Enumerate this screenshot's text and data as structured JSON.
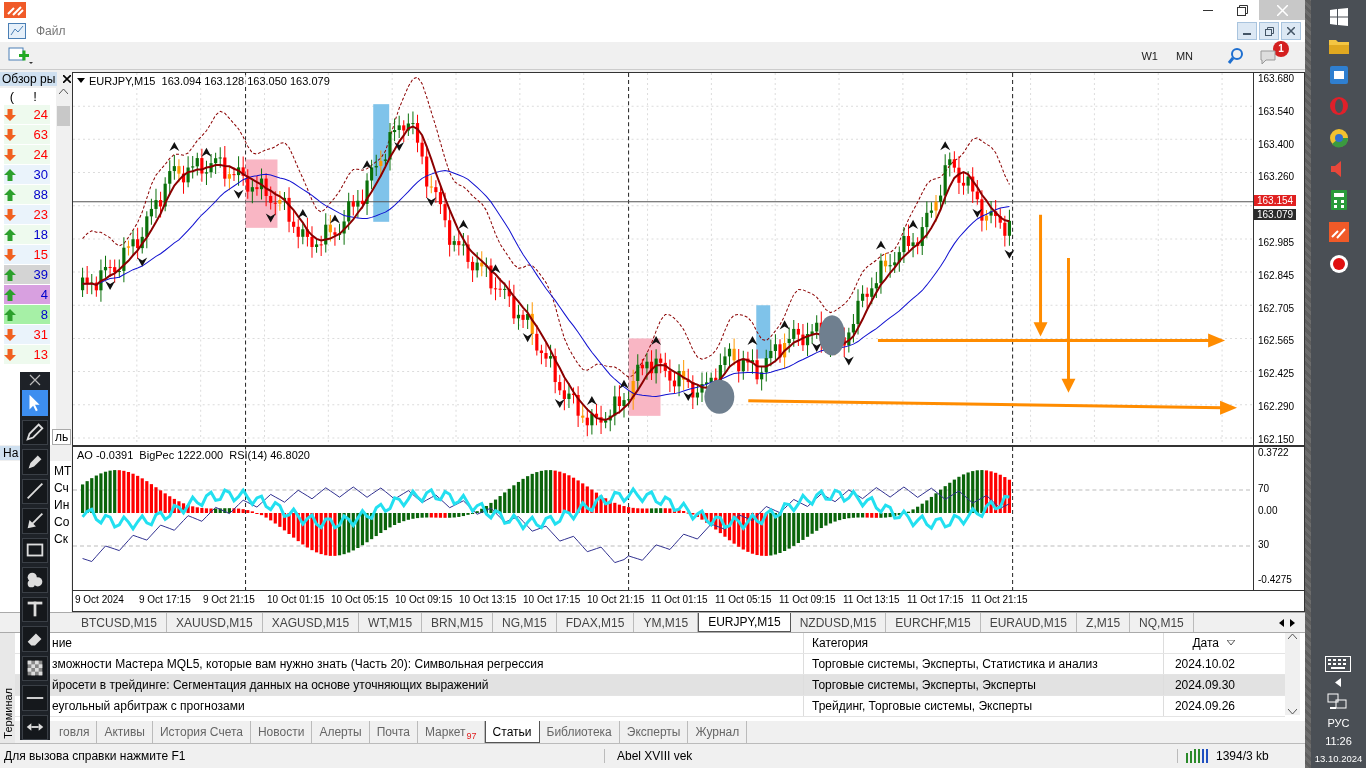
{
  "menu": [
    {
      "label": "Файл"
    }
  ],
  "toolbar": {
    "timeframes": [
      {
        "label": "W1",
        "selected": false
      },
      {
        "label": "MN",
        "selected": false
      }
    ],
    "notification_badge": "1"
  },
  "market_watch": {
    "title": "Обзор ры",
    "columns": [
      "(",
      "!"
    ],
    "tab": "ль",
    "rows": [
      {
        "kind": "down",
        "value": "24",
        "color": "#eefaee"
      },
      {
        "kind": "down",
        "value": "63",
        "color": "#eefaee"
      },
      {
        "kind": "down",
        "value": "24",
        "color": "#eefaee"
      },
      {
        "kind": "up",
        "value": "30",
        "color": "#eaf3fb"
      },
      {
        "kind": "up",
        "value": "88",
        "color": "#eefaee"
      },
      {
        "kind": "down",
        "value": "23",
        "color": "#eaf3fb"
      },
      {
        "kind": "up",
        "value": "18",
        "color": "#eefaee"
      },
      {
        "kind": "down",
        "value": "15",
        "color": "#eaf3fb"
      },
      {
        "kind": "up",
        "value": "39",
        "color": "#d4d4d4"
      },
      {
        "kind": "up",
        "value": "4",
        "color": "#d8a0e0"
      },
      {
        "kind": "up",
        "value": "8",
        "color": "#a6f0a6"
      },
      {
        "kind": "down",
        "value": "31",
        "color": "#eaf3fb"
      },
      {
        "kind": "down",
        "value": "13",
        "color": "#eefaee"
      }
    ]
  },
  "navigator": {
    "title": "На",
    "items": [
      "МТ",
      "Сч",
      "Ин",
      "Со",
      "Ск"
    ]
  },
  "drawing_tools": [
    {
      "kind": "cursor",
      "selected": true
    },
    {
      "kind": "pencil",
      "selected": false
    },
    {
      "kind": "marker",
      "selected": false
    },
    {
      "kind": "line",
      "selected": false
    },
    {
      "kind": "arrow",
      "selected": false
    },
    {
      "kind": "rectangle",
      "selected": false
    },
    {
      "kind": "numbers",
      "selected": false
    },
    {
      "kind": "text",
      "selected": false
    },
    {
      "kind": "eraser",
      "selected": false
    },
    {
      "kind": "fill",
      "selected": false
    },
    {
      "kind": "hline",
      "selected": false
    },
    {
      "kind": "resize",
      "selected": false
    }
  ],
  "chart": {
    "header": "EURJPY,M15  163.094 163.128 163.050 163.079",
    "price_axis": [
      "163.680",
      "163.540",
      "163.400",
      "163.260",
      "162.985",
      "162.845",
      "162.705",
      "162.565",
      "162.425",
      "162.290",
      "162.150"
    ],
    "price_badges": [
      {
        "kind": "bid",
        "label": "163.154"
      },
      {
        "kind": "last",
        "label": "163.079"
      }
    ],
    "time_axis": [
      "9 Oct 2024",
      "9 Oct 17:15",
      "9 Oct 21:15",
      "10 Oct 01:15",
      "10 Oct 05:15",
      "10 Oct 09:15",
      "10 Oct 13:15",
      "10 Oct 17:15",
      "10 Oct 21:15",
      "11 Oct 01:15",
      "11 Oct 05:15",
      "11 Oct 09:15",
      "11 Oct 13:15",
      "11 Oct 17:15",
      "11 Oct 21:15"
    ]
  },
  "indicator": {
    "header": "AO -0.0391  BigPec 1222.000  RSI(14) 46.8020",
    "axis": [
      "0.3722",
      "70",
      "0.00",
      "30",
      "-0.4275"
    ]
  },
  "symbol_tabs": [
    {
      "label": "BTCUSD,M15",
      "selected": false
    },
    {
      "label": "XAUUSD,M15",
      "selected": false
    },
    {
      "label": "XAGUSD,M15",
      "selected": false
    },
    {
      "label": "WT,M15",
      "selected": false
    },
    {
      "label": "BRN,M15",
      "selected": false
    },
    {
      "label": "NG,M15",
      "selected": false
    },
    {
      "label": "FDAX,M15",
      "selected": false
    },
    {
      "label": "YM,M15",
      "selected": false
    },
    {
      "label": "EURJPY,M15",
      "selected": true
    },
    {
      "label": "NZDUSD,M15",
      "selected": false
    },
    {
      "label": "EURCHF,M15",
      "selected": false
    },
    {
      "label": "EURAUD,M15",
      "selected": false
    },
    {
      "label": "Z,M15",
      "selected": false
    },
    {
      "label": "NQ,M15",
      "selected": false
    }
  ],
  "terminal": {
    "side_label": "Терминал",
    "columns": [
      "ние",
      "Категория",
      "Дата"
    ],
    "rows": [
      {
        "title": "зможности Мастера MQL5, которые вам нужно знать (Часть 20): Символьная регрессия",
        "category": "Торговые системы, Эксперты, Статистика и анализ",
        "date": "2024.10.02",
        "selected": false
      },
      {
        "title": "йросети в трейдинге: Сегментация данных на основе уточняющих выражений",
        "category": "Торговые системы, Эксперты, Эксперты",
        "date": "2024.09.30",
        "selected": true
      },
      {
        "title": "еугольный арбитраж с прогнозами",
        "category": "Трейдинг, Торговые системы, Эксперты",
        "date": "2024.09.26",
        "selected": false
      }
    ],
    "tabs": [
      {
        "label": "говля",
        "selected": false
      },
      {
        "label": "Активы",
        "selected": false
      },
      {
        "label": "История Счета",
        "selected": false
      },
      {
        "label": "Новости",
        "selected": false
      },
      {
        "label": "Алерты",
        "selected": false
      },
      {
        "label": "Почта",
        "selected": false
      },
      {
        "label": "Маркет",
        "badge": "97",
        "selected": false
      },
      {
        "label": "Статьи",
        "selected": true
      },
      {
        "label": "Библиотека",
        "selected": false
      },
      {
        "label": "Эксперты",
        "selected": false
      },
      {
        "label": "Журнал",
        "selected": false
      }
    ]
  },
  "status_bar": {
    "help": "Для вызова справки нажмите F1",
    "profile": "Abel XVIII vek",
    "traffic": "1394/3 kb"
  },
  "taskbar": {
    "language": "РУС",
    "time": "11:26",
    "date": "13.10.2024"
  }
}
